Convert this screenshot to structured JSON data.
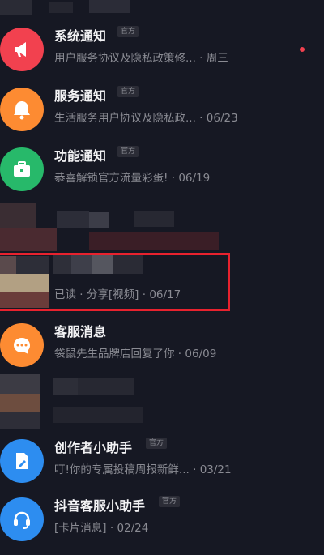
{
  "colors": {
    "background": "#161823",
    "title": "#f2f2f4",
    "subtitle": "#8a8b93",
    "highlight_box": "#e8222e",
    "red_icon": "#f2414f",
    "orange_icon": "#fd8b32",
    "green_icon": "#27b96a",
    "blue_icon": "#2d8df0"
  },
  "badge_label": "官方",
  "messages": [
    {
      "title": "系统通知",
      "badge": "官方",
      "preview": "用户服务协议及隐私政策修...",
      "time": "周三",
      "icon": "megaphone-icon"
    },
    {
      "title": "服务通知",
      "badge": "官方",
      "preview": "生活服务用户协议及隐私政...",
      "time": "06/23",
      "icon": "bell-icon"
    },
    {
      "title": "功能通知",
      "badge": "官方",
      "preview": "恭喜解锁官方流量彩蛋!",
      "time": "06/19",
      "icon": "briefcase-icon"
    },
    {
      "title": "",
      "preview": "已读 · 分享[视频]",
      "time": "06/17",
      "icon": "blurred-avatar",
      "highlighted": true
    },
    {
      "title": "客服消息",
      "preview": "袋鼠先生品牌店回复了你",
      "time": "06/09",
      "icon": "chat-bubble-icon"
    },
    {
      "title": "创作者小助手",
      "badge": "官方",
      "preview": "叮!你的专属投稿周报新鲜...",
      "time": "03/21",
      "icon": "document-pen-icon"
    },
    {
      "title": "抖音客服小助手",
      "badge": "官方",
      "preview": "[卡片消息]",
      "time": "02/24",
      "icon": "headset-icon"
    }
  ]
}
